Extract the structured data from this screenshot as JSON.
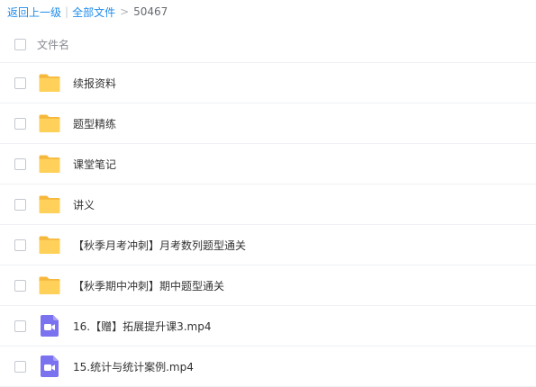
{
  "breadcrumb": {
    "back": "返回上一级",
    "separator": "|",
    "all_files": "全部文件",
    "arrow": ">",
    "current": "50467"
  },
  "header": {
    "column_name": "文件名"
  },
  "files": [
    {
      "name": "续报资料",
      "icon": "folder-icon"
    },
    {
      "name": "题型精练",
      "icon": "folder-icon"
    },
    {
      "name": "课堂笔记",
      "icon": "folder-icon"
    },
    {
      "name": "讲义",
      "icon": "folder-icon"
    },
    {
      "name": "【秋季月考冲刺】月考数列题型通关",
      "icon": "folder-icon"
    },
    {
      "name": "【秋季期中冲刺】期中题型通关",
      "icon": "folder-icon"
    },
    {
      "name": "16.【赠】拓展提升课3.mp4",
      "icon": "video-file-icon"
    },
    {
      "name": "15.统计与统计案例.mp4",
      "icon": "video-file-icon"
    }
  ],
  "colors": {
    "link": "#1f8ceb",
    "folder": "#ffd15b",
    "video": "#7b72f0"
  }
}
